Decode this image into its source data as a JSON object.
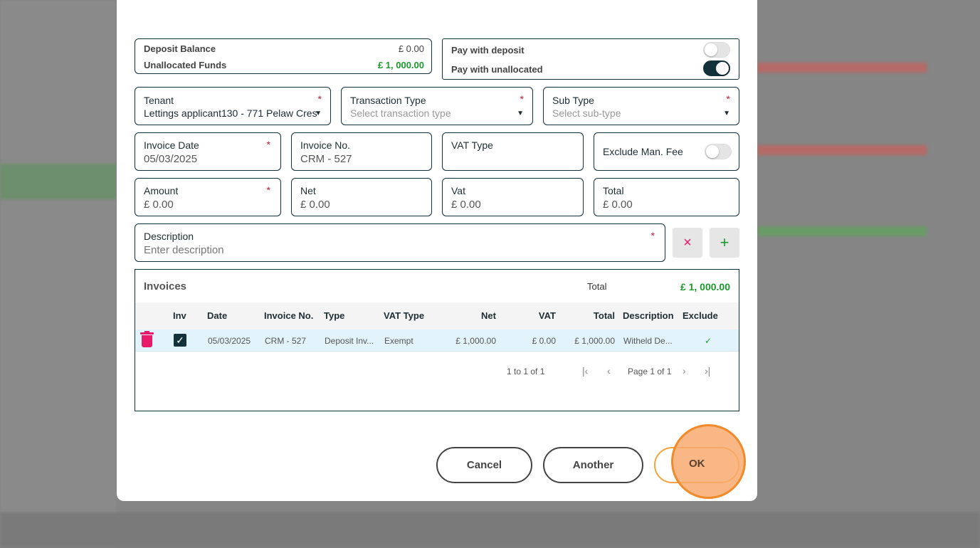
{
  "balances": {
    "deposit_label": "Deposit Balance",
    "deposit_value": "£ 0.00",
    "unallocated_label": "Unallocated Funds",
    "unallocated_value": "£ 1, 000.00"
  },
  "pay": {
    "deposit_label": "Pay with deposit",
    "deposit_on": false,
    "unallocated_label": "Pay with unallocated",
    "unallocated_on": true
  },
  "fields": {
    "tenant": {
      "label": "Tenant",
      "value": "Lettings applicant130 - 771 Pelaw Cres"
    },
    "transaction_type": {
      "label": "Transaction Type",
      "placeholder": "Select transaction type"
    },
    "sub_type": {
      "label": "Sub Type",
      "placeholder": "Select sub-type"
    },
    "invoice_date": {
      "label": "Invoice Date",
      "value": "05/03/2025"
    },
    "invoice_no": {
      "label": "Invoice No.",
      "value": "CRM - 527"
    },
    "vat_type": {
      "label": "VAT Type",
      "value": ""
    },
    "exclude_fee": {
      "label": "Exclude Man. Fee",
      "on": false
    },
    "amount": {
      "label": "Amount",
      "value": "£ 0.00"
    },
    "net": {
      "label": "Net",
      "value": "£ 0.00"
    },
    "vat": {
      "label": "Vat",
      "value": "£ 0.00"
    },
    "total": {
      "label": "Total",
      "value": "£ 0.00"
    },
    "description": {
      "label": "Description",
      "placeholder": "Enter description"
    },
    "required": "*"
  },
  "invoices": {
    "title": "Invoices",
    "total_label": "Total",
    "total_value": "£ 1, 000.00",
    "columns": [
      "Inv",
      "Date",
      "Invoice No.",
      "Type",
      "VAT Type",
      "Net",
      "VAT",
      "Total",
      "Description",
      "Exclude"
    ],
    "rows": [
      {
        "date": "05/03/2025",
        "invoice_no": "CRM - 527",
        "type": "Deposit Inv...",
        "vat_type": "Exempt",
        "net": "£ 1,000.00",
        "vat": "£ 0.00",
        "total": "£ 1,000.00",
        "description": "Witheld De...",
        "exclude": "✓"
      }
    ],
    "pagination": {
      "range": "1 to 1 of 1",
      "page": "Page 1 of 1"
    }
  },
  "buttons": {
    "cancel": "Cancel",
    "another": "Another",
    "ok": "OK",
    "clear": "×",
    "add": "+"
  },
  "colors": {
    "accent": "#12313a",
    "green": "#1a9a2a",
    "danger": "#e8186a",
    "ok": "#f2a43a"
  }
}
